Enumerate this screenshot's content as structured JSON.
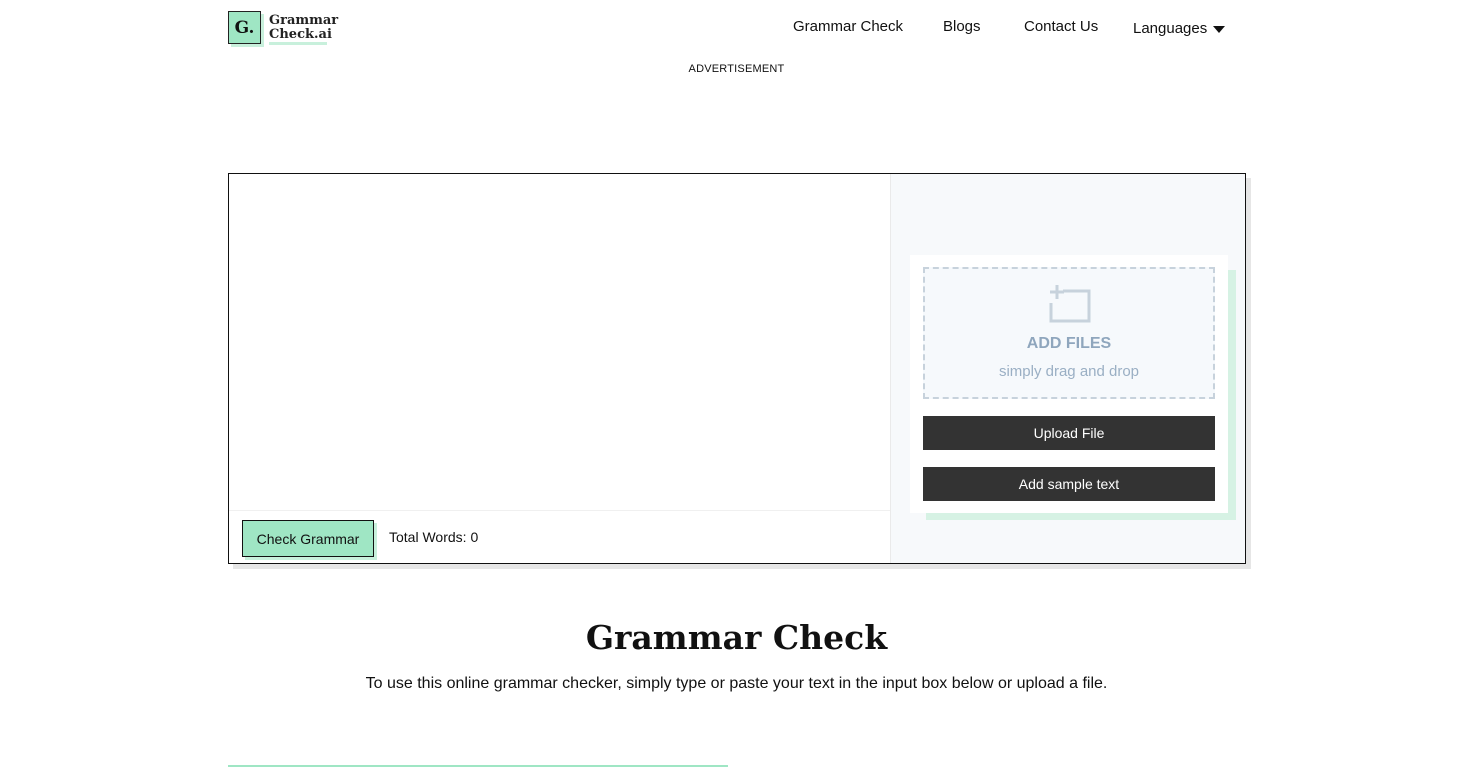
{
  "logo": {
    "mark": "G.",
    "line1": "Grammar",
    "line2": "Check.ai"
  },
  "nav": {
    "items": [
      "Grammar Check",
      "Blogs",
      "Contact Us"
    ],
    "languages_label": "Languages"
  },
  "advertisement_label": "ADVERTISEMENT",
  "editor": {
    "textarea_value": "",
    "check_button_label": "Check Grammar",
    "total_words_label": "Total Words:",
    "total_words_count": "0"
  },
  "upload": {
    "drop_title": "ADD FILES",
    "drop_subtitle": "simply drag and drop",
    "upload_button_label": "Upload File",
    "sample_button_label": "Add sample text"
  },
  "section": {
    "title": "Grammar Check",
    "description": "To use this online grammar checker, simply type or paste your text in the input box below or upload a file."
  },
  "colors": {
    "accent": "#9fe6c4",
    "accent_light": "#c8f0dc",
    "dark_button": "#333333",
    "drop_text": "#8fa6bd"
  },
  "icons": {
    "add_file": "add-file-icon",
    "languages_caret": "caret-down-icon"
  }
}
